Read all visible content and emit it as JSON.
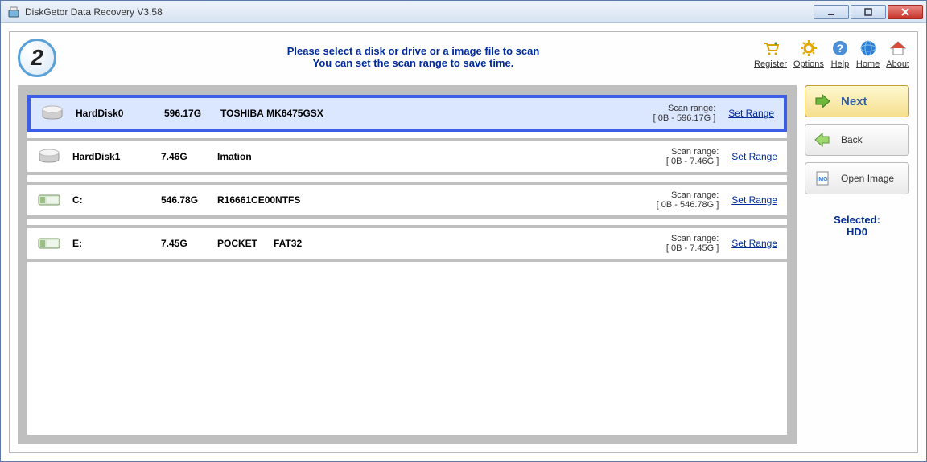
{
  "window": {
    "title": "DiskGetor Data Recovery V3.58"
  },
  "step": "2",
  "header": {
    "line1": "Please select a disk or drive or a image file to scan",
    "line2": "You can set the scan range to save time."
  },
  "toolbar": {
    "register": "Register",
    "options": "Options",
    "help": "Help",
    "home": "Home",
    "about": "About"
  },
  "disks": [
    {
      "name": "HardDisk0",
      "size": "596.17G",
      "model": "TOSHIBA MK6475GSX",
      "range_label": "Scan range:",
      "range": "[ 0B - 596.17G ]",
      "set_range": "Set Range",
      "selected": true,
      "type": "hdd"
    },
    {
      "name": "HardDisk1",
      "size": "7.46G",
      "model": "Imation",
      "range_label": "Scan range:",
      "range": "[ 0B - 7.46G ]",
      "set_range": "Set Range",
      "selected": false,
      "type": "hdd"
    },
    {
      "name": "C:",
      "size": "546.78G",
      "model": "R16661CE00NTFS",
      "range_label": "Scan range:",
      "range": "[ 0B - 546.78G ]",
      "set_range": "Set Range",
      "selected": false,
      "type": "part"
    },
    {
      "name": "E:",
      "size": "7.45G",
      "model": "POCKET      FAT32",
      "range_label": "Scan range:",
      "range": "[ 0B - 7.45G ]",
      "set_range": "Set Range",
      "selected": false,
      "type": "part"
    }
  ],
  "sidebar": {
    "next": "Next",
    "back": "Back",
    "open_image": "Open Image",
    "selected_label": "Selected:",
    "selected_value": "HD0"
  }
}
